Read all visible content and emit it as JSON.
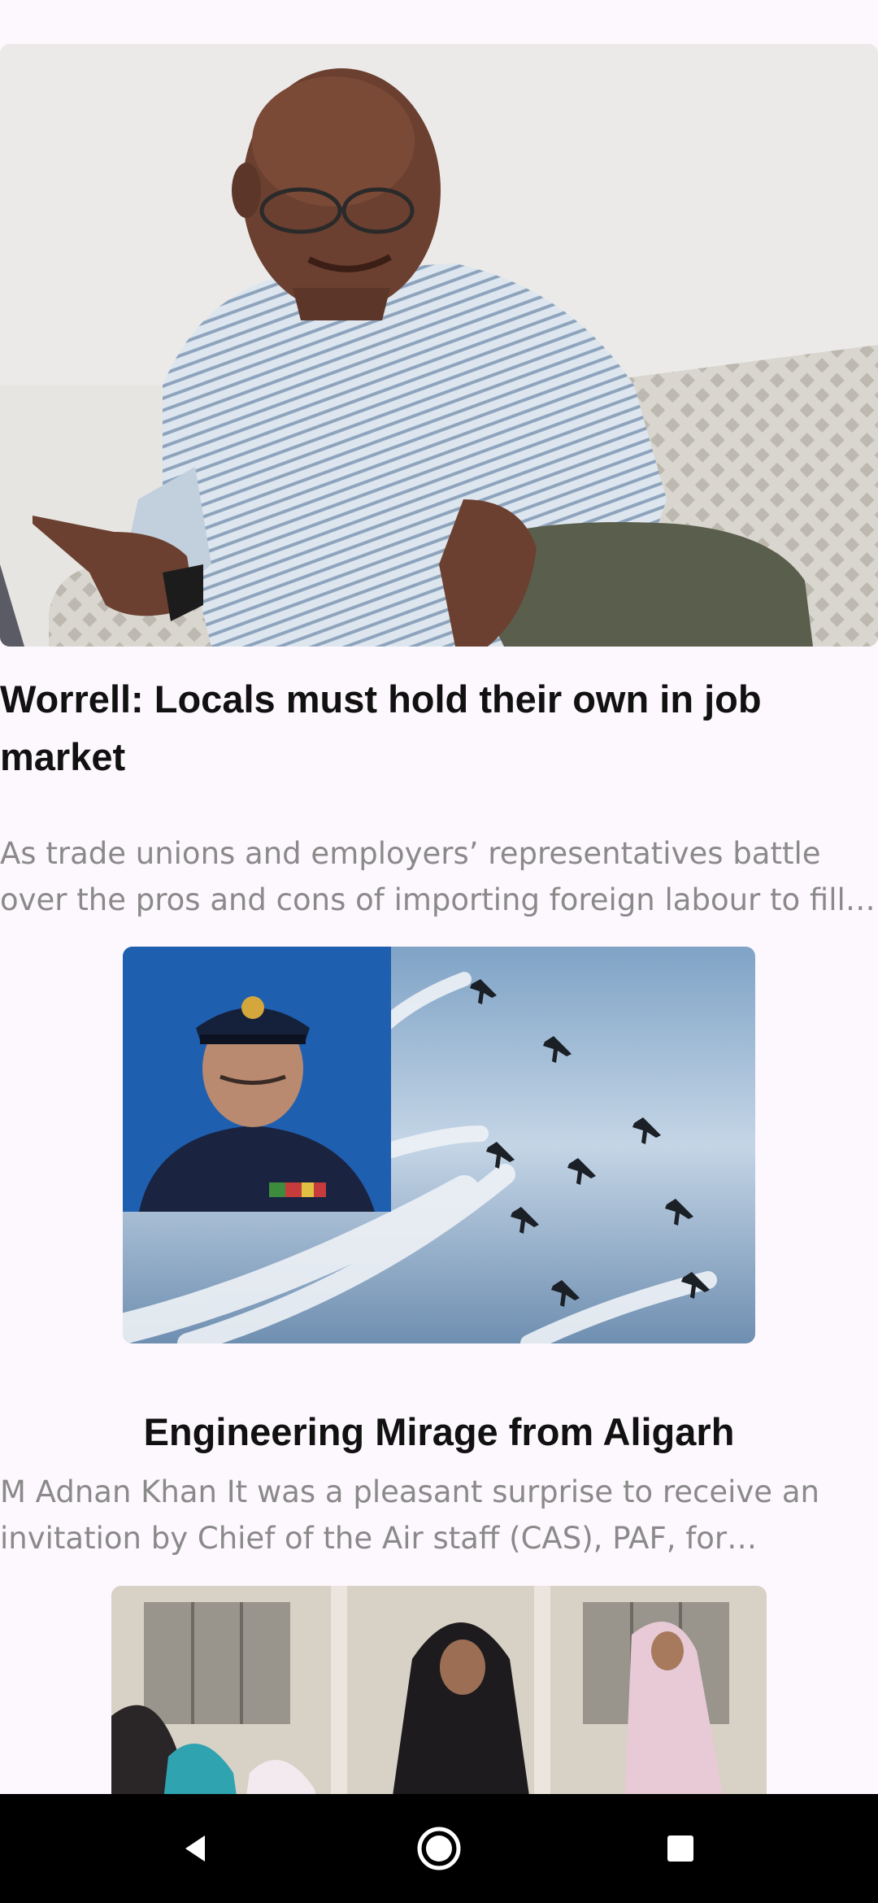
{
  "articles": [
    {
      "title": "Worrell: Locals must hold their own in job market",
      "summary": "As trade unions and employers’ representatives battle over the pros and cons of importing foreign labour to fill jobs",
      "image": "man-seated-on-sofa-photo"
    },
    {
      "title": "Engineering Mirage from Aligarh",
      "summary": "M Adnan Khan It was a pleasant surprise to receive an invitation by Chief of the Air staff (CAS), PAF, for attending the ceremony",
      "image": "air-chief-and-jet-formation-photo"
    },
    {
      "title": "",
      "summary": "",
      "image": "women-in-classroom-photo"
    }
  ],
  "nav": {
    "back_icon": "back-triangle-icon",
    "home_icon": "home-circle-icon",
    "recents_icon": "recents-square-icon"
  },
  "colors": {
    "background": "#fdf8fd",
    "headline": "#111111",
    "summary": "#8a8a8a",
    "nav_bar": "#000000"
  }
}
